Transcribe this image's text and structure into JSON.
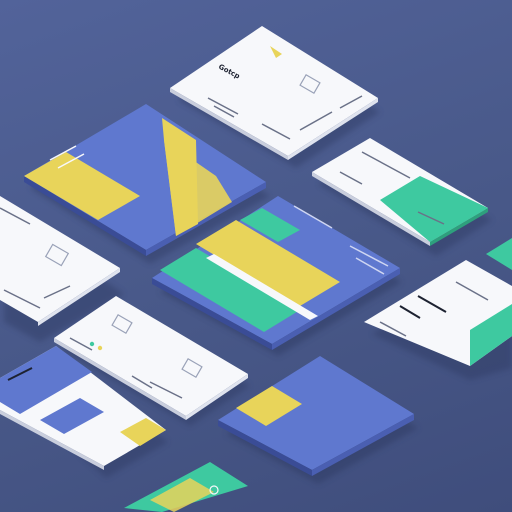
{
  "scene": {
    "description_label": "",
    "colors": {
      "background": "#4a5a8e",
      "card_white": "#f7f8fb",
      "card_blue": "#5f78cf",
      "accent_yellow": "#e8d45a",
      "accent_green": "#3ec9a0",
      "ink": "#1d2231",
      "shadow": "#2f3a63"
    }
  },
  "cards": {
    "top_white": {
      "heading": "Gotcp"
    },
    "right_mid_white": {
      "heading": ""
    },
    "right_lower_white": {
      "heading": ""
    },
    "left_white": {
      "heading": ""
    },
    "bottom_left_white": {
      "heading": ""
    }
  }
}
